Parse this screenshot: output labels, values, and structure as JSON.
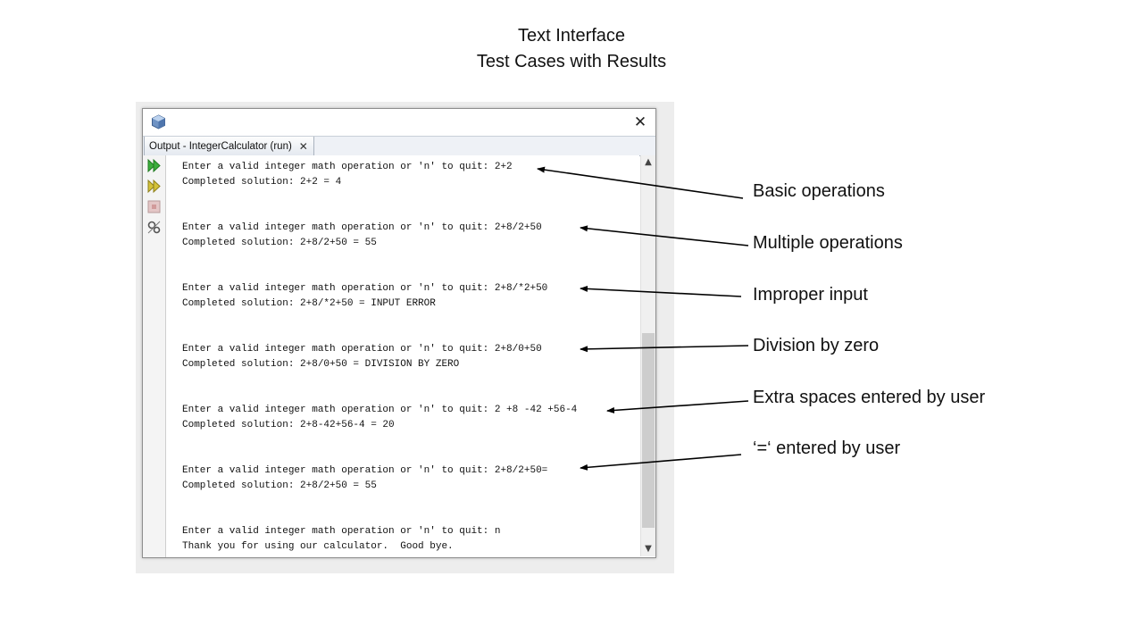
{
  "page_title": {
    "line1": "Text Interface",
    "line2": "Test Cases with Results"
  },
  "window": {
    "tab_label": "Output - IntegerCalculator (run)",
    "tab_close": "✕",
    "close_glyph": "✕",
    "toolbar_icons": [
      "rerun-icon",
      "rerun-with-options-icon",
      "stop-icon",
      "settings-icon"
    ]
  },
  "console_lines": [
    "Enter a valid integer math operation or 'n' to quit: 2+2",
    "Completed solution: 2+2 = 4",
    "Enter a valid integer math operation or 'n' to quit: 2+8/2+50",
    "Completed solution: 2+8/2+50 = 55",
    "Enter a valid integer math operation or 'n' to quit: 2+8/*2+50",
    "Completed solution: 2+8/*2+50 = INPUT ERROR",
    "Enter a valid integer math operation or 'n' to quit: 2+8/0+50",
    "Completed solution: 2+8/0+50 = DIVISION BY ZERO",
    "Enter a valid integer math operation or 'n' to quit: 2 +8 -42 +56-4",
    "Completed solution: 2+8-42+56-4 = 20",
    "Enter a valid integer math operation or 'n' to quit: 2+8/2+50=",
    "Completed solution: 2+8/2+50 = 55",
    "Enter a valid integer math operation or 'n' to quit: n",
    "Thank you for using our calculator.  Good bye."
  ],
  "annotations": [
    "Basic operations",
    "Multiple operations",
    "Improper input",
    "Division by zero",
    "Extra spaces entered by user",
    "‘=‘ entered by user"
  ]
}
